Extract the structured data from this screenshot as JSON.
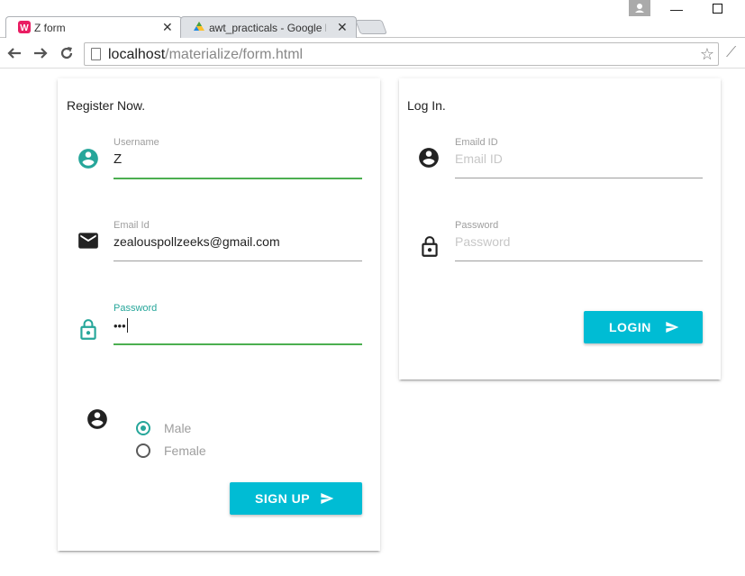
{
  "browser": {
    "tabs": [
      {
        "title": "Z form",
        "active": true
      },
      {
        "title": "awt_practicals - Google Dr",
        "active": false
      }
    ],
    "url_host": "localhost",
    "url_path": "/materialize/form.html"
  },
  "register": {
    "title": "Register Now.",
    "username": {
      "label": "Username",
      "value": "Z"
    },
    "email": {
      "label": "Email Id",
      "value": "zealouspollzeeks@gmail.com"
    },
    "password": {
      "label": "Password",
      "value": "•••"
    },
    "gender_options": [
      {
        "label": "Male",
        "checked": true
      },
      {
        "label": "Female",
        "checked": false
      }
    ],
    "submit_label": "SIGN UP"
  },
  "login": {
    "title": "Log In.",
    "email": {
      "label": "Emaild ID",
      "placeholder": "Email ID"
    },
    "password": {
      "label": "Password",
      "placeholder": "Password"
    },
    "submit_label": "LOGIN"
  },
  "colors": {
    "accent": "#26a69a",
    "button": "#00bcd4",
    "valid": "#4caf50"
  },
  "icons": [
    "account-circle-icon",
    "email-icon",
    "lock-icon",
    "send-icon",
    "star-icon",
    "page-icon"
  ]
}
